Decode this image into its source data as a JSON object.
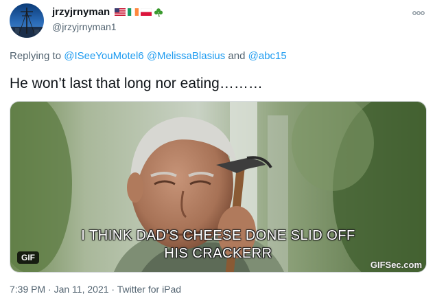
{
  "author": {
    "display_name": "jrzyjrnyman",
    "handle": "@jrzyjrnyman1",
    "flag_icons": [
      "us-flag-icon",
      "ireland-flag-icon",
      "poland-flag-icon",
      "shamrock-icon"
    ]
  },
  "reply": {
    "prefix": "Replying to",
    "mentions": [
      "@ISeeYouMotel6",
      "@MelissaBlasius",
      "@abc15"
    ],
    "conjunction": "and"
  },
  "tweet": {
    "text": "He won’t last that long nor eating………"
  },
  "media": {
    "caption_line1": "I THINK DAD'S CHEESE DONE SLID OFF",
    "caption_line2": "HIS CRACKERR",
    "badge": "GIF",
    "watermark": "GIFSec.com"
  },
  "meta": {
    "time": "7:39 PM",
    "date": "Jan 11, 2021",
    "source": "Twitter for iPad",
    "separator": " · "
  },
  "colors": {
    "link": "#1d9bf0",
    "secondary_text": "#536471",
    "primary_text": "#0f1419"
  }
}
